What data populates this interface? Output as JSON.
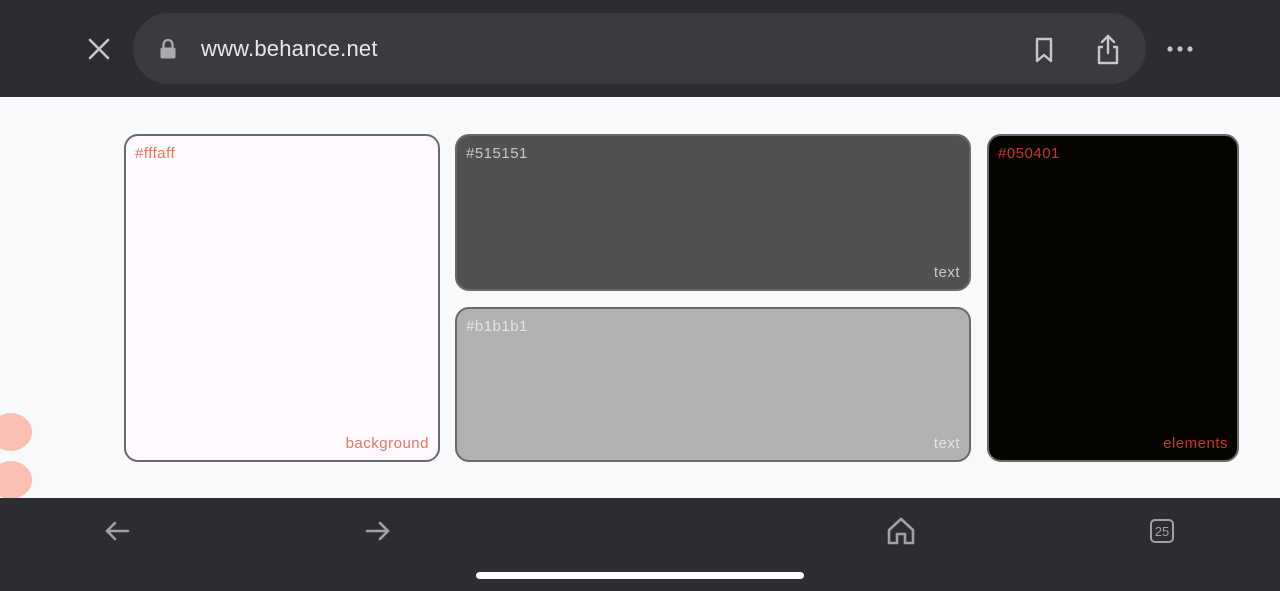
{
  "browser": {
    "url": "www.behance.net",
    "tabs_count": "25",
    "icons": [
      "close-icon",
      "lock-icon",
      "bookmark-icon",
      "share-icon",
      "more-icon",
      "back-arrow-icon",
      "forward-arrow-icon",
      "home-icon",
      "tabs-icon"
    ]
  },
  "palette": [
    {
      "hex": "#fffaff",
      "role": "background",
      "label_color": "#e8745f"
    },
    {
      "hex": "#515151",
      "role": "text",
      "label_color": "#c9c9c9"
    },
    {
      "hex": "#b1b1b1",
      "role": "text",
      "label_color": "#e4e4e4"
    },
    {
      "hex": "#050401",
      "role": "elements",
      "label_color": "#c8371f"
    }
  ],
  "colors": {
    "chrome": "#2c2d31",
    "urlbar": "#3a3b40",
    "page": "#f8f9fb",
    "decoration": "#f9bfb0"
  }
}
